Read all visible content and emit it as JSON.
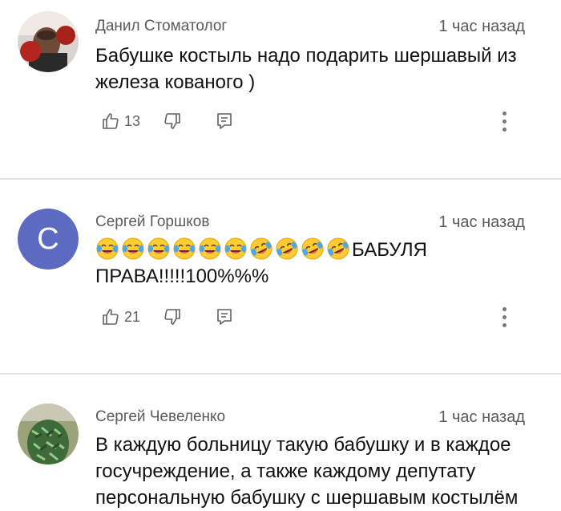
{
  "comments": [
    {
      "author": "Данил Стоматолог",
      "time": "1 час назад",
      "text": "Бабушке костыль надо подарить шершавый из железа кованого )",
      "likes": "13",
      "avatar_color": "#3a2a22"
    },
    {
      "author": "Сергей Горшков",
      "time": "1 час назад",
      "text_lead_emoji": [
        "😂",
        "😂",
        "😂",
        "😂",
        "😂",
        "😂",
        "🤣",
        "🤣",
        "🤣",
        "🤣"
      ],
      "text": "БАБУЛЯ ПРАВА!!!!!100%%%",
      "likes": "21",
      "avatar_letter": "С",
      "avatar_color": "#5c6bc0"
    },
    {
      "author": "Сергей Чевеленко",
      "time": "1 час назад",
      "text": "В каждую больницу такую бабушку и в каждое госучреждение, а также каждому депутату персональную бабушку с шершавым костылём",
      "avatar_color": "#6a7a4a"
    }
  ]
}
